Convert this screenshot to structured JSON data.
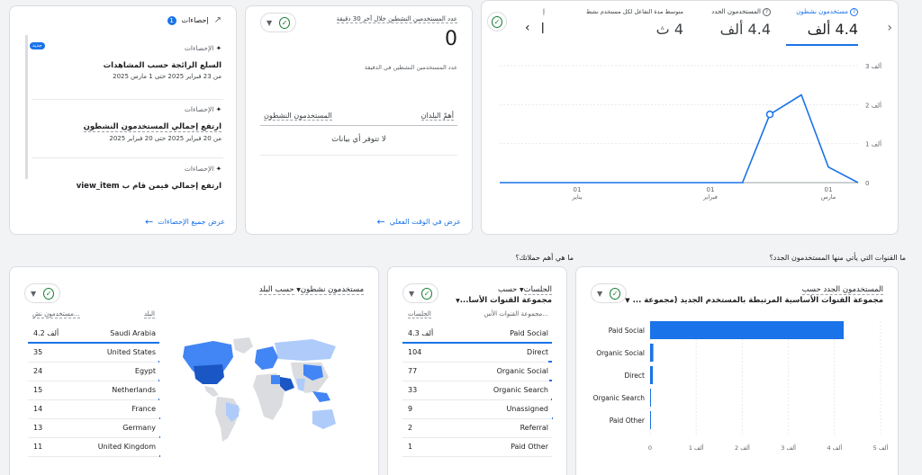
{
  "insights_card": {
    "title": "إحصاءات",
    "badge_count": "1",
    "new_badge": "جديد",
    "items": [
      {
        "kicker": "الإحصاءات",
        "title": "السلع الرائجة حسب المشاهدات",
        "date": "من 23 فبراير 2025 حتى 1 مارس 2025"
      },
      {
        "kicker": "الإحصاءات",
        "title": "ارتفع إجمالي المستخدمون النشطون",
        "date": "من 20 فبراير 2025 حتى 20 فبراير 2025"
      },
      {
        "kicker": "الإحصاءات",
        "title": "ارتفع إجمالي فيمن قام ب view_item",
        "date": ""
      }
    ],
    "link": "عرض جميع الإحصاءات"
  },
  "realtime_card": {
    "metric_label": "عدد المستخدمين النشطين خلال آخر 30 دقيقة",
    "metric_value": "0",
    "per_minute_label": "عدد المستخدمين النشطين في الدقيقة",
    "col_country": "أهمّ البلدان",
    "col_users": "المستخدمون النشطون",
    "empty": "لا تتوفر أي بيانات",
    "link": "عرض في الوقت الفعلي"
  },
  "overview_card": {
    "tabs": [
      {
        "label": "مستخدمون نشطون",
        "value": "4.4 ألف",
        "active": true
      },
      {
        "label": "المستخدمون الجدد",
        "value": "4.4 ألف",
        "active": false
      },
      {
        "label": "متوسط مدة التفاعل لكل مستخدم نشط",
        "value": "4 ث",
        "active": false
      },
      {
        "label": "إ",
        "value": "ا",
        "active": false
      }
    ],
    "prev_icon": "‹",
    "next_icon": "›"
  },
  "chart_data": [
    {
      "type": "line",
      "x": [
        "01 يناير",
        "",
        "",
        "",
        "",
        "",
        "",
        "",
        "01 فبراير",
        "",
        "",
        "",
        "",
        "",
        "",
        "01 مارس"
      ],
      "x_ticks": [
        {
          "day": "01",
          "month": "يناير",
          "index": 0
        },
        {
          "day": "01",
          "month": "فبراير",
          "index": 8
        },
        {
          "day": "01",
          "month": "مارس",
          "index": 15
        }
      ],
      "y_ticks": [
        "3 ألف",
        "2 ألف",
        "1 ألف",
        "0"
      ],
      "ylim": [
        0,
        3000
      ],
      "series": [
        {
          "values": [
            0,
            0,
            0,
            0,
            0,
            0,
            0,
            0,
            0,
            0,
            0,
            20,
            1750,
            2250,
            400,
            0
          ]
        }
      ],
      "highlight_index": 12
    },
    {
      "type": "bar",
      "title": "المستخدمون الجدد حسب",
      "subtitle": "مجموعة القنوات الأساسية المرتبطة بالمستخدم الجديد (مجموعة ...",
      "categories": [
        "Paid Social",
        "Organic Social",
        "Direct",
        "Organic Search",
        "Paid Other"
      ],
      "values": [
        4200,
        70,
        60,
        20,
        1
      ],
      "x_ticks": [
        "0",
        "1 ألف",
        "2 ألف",
        "3 ألف",
        "4 ألف",
        "5 ألف"
      ],
      "xlim": [
        0,
        5000
      ]
    }
  ],
  "section_titles": {
    "left": "ما القنوات التي يأتي منها المستخدمون الجدد؟",
    "right": "ما هي أهم حملاتك؟"
  },
  "sessions_card": {
    "title_metric": "الجلسات",
    "title_by": "حسب",
    "title_dim": "مجموعة القنوات الأسا...",
    "col_dim": "مجموعة القنوات الأس...",
    "col_val": "الجلسات",
    "rows": [
      {
        "name": "Paid Social",
        "value": "4.3 ألف",
        "fill": 1.0
      },
      {
        "name": "Direct",
        "value": "104",
        "fill": 0.024
      },
      {
        "name": "Organic Social",
        "value": "77",
        "fill": 0.018
      },
      {
        "name": "Organic Search",
        "value": "33",
        "fill": 0.008
      },
      {
        "name": "Unassigned",
        "value": "9",
        "fill": 0.002
      },
      {
        "name": "Referral",
        "value": "2",
        "fill": 0.0
      },
      {
        "name": "Paid Other",
        "value": "1",
        "fill": 0.0
      }
    ]
  },
  "country_card": {
    "title_metric": "مستخدمون نشطون",
    "title_by": "حسب البلد",
    "col_country": "البلد",
    "col_users": "مستخدمون نش...",
    "rows": [
      {
        "name": "Saudi Arabia",
        "value": "4.2 ألف",
        "fill": 1.0
      },
      {
        "name": "United States",
        "value": "35",
        "fill": 0.008
      },
      {
        "name": "Egypt",
        "value": "24",
        "fill": 0.006
      },
      {
        "name": "Netherlands",
        "value": "15",
        "fill": 0.004
      },
      {
        "name": "France",
        "value": "14",
        "fill": 0.003
      },
      {
        "name": "Germany",
        "value": "13",
        "fill": 0.003
      },
      {
        "name": "United Kingdom",
        "value": "11",
        "fill": 0.003
      }
    ]
  },
  "colors": {
    "accent": "#1a73e8",
    "good": "#188038",
    "bar": "#1a73e8",
    "map_light": "#aecbfa",
    "map_mid": "#4285f4",
    "map_dark": "#1a56c4",
    "map_none": "#dadce0"
  }
}
